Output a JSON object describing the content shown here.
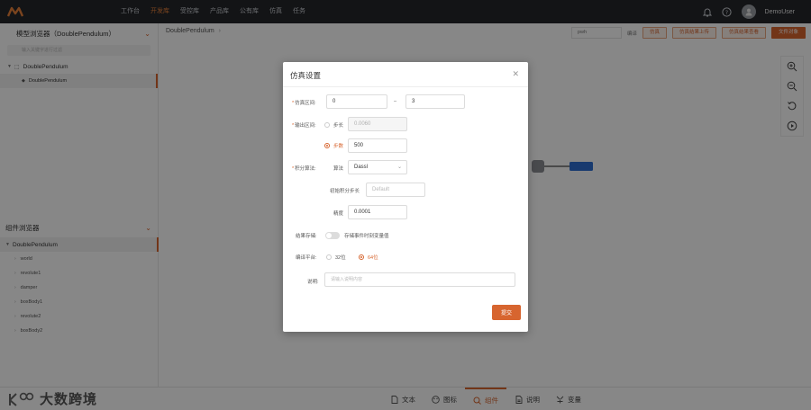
{
  "nav": {
    "items": [
      "工作台",
      "开发库",
      "受控库",
      "产品库",
      "公有库",
      "仿真",
      "任务"
    ],
    "active_index": 1,
    "username": "DemoUser"
  },
  "model_browser": {
    "title": "模型浏览器（DoublePendulum）",
    "search_placeholder": "输入关键字进行过滤",
    "root": "DoublePendulum",
    "child": "DoublePendulum"
  },
  "component_browser": {
    "title": "组件浏览器",
    "root": "DoublePendulum",
    "items": [
      "world",
      "revolute1",
      "damper",
      "boxBody1",
      "revolute2",
      "boxBody2"
    ]
  },
  "breadcrumb": "DoublePendulum",
  "toolbar": {
    "select_value": "pwh",
    "text": "编译",
    "btn1": "仿真",
    "btn2": "仿真结果上传",
    "btn3": "仿真结果查看",
    "btn4": "文件对象"
  },
  "bottom": {
    "brand": "大数跨境",
    "tabs": [
      "文本",
      "图标",
      "组件",
      "说明",
      "变量"
    ],
    "active_tab": 2
  },
  "dialog": {
    "title": "仿真设置",
    "interval_label": "仿真区间:",
    "interval_start": "0",
    "interval_sep": "–",
    "interval_end": "3",
    "output_label": "输出区间:",
    "step_label": "步长",
    "step_value": "0.0060",
    "count_label": "步数",
    "count_value": "500",
    "integration_label": "积分算法:",
    "algorithm_label": "算法",
    "algorithm_value": "Dassl",
    "initial_step_label": "初始积分步长",
    "initial_step_placeholder": "Default",
    "tolerance_label": "精度",
    "tolerance_value": "0.0001",
    "storage_label": "结果存储:",
    "storage_switch_label": "存储事件时刻变量值",
    "platform_label": "编译平台:",
    "platform_32": "32位",
    "platform_64": "64位",
    "description_label": "说明:",
    "description_placeholder": "请输入说明内容",
    "submit": "提交"
  }
}
